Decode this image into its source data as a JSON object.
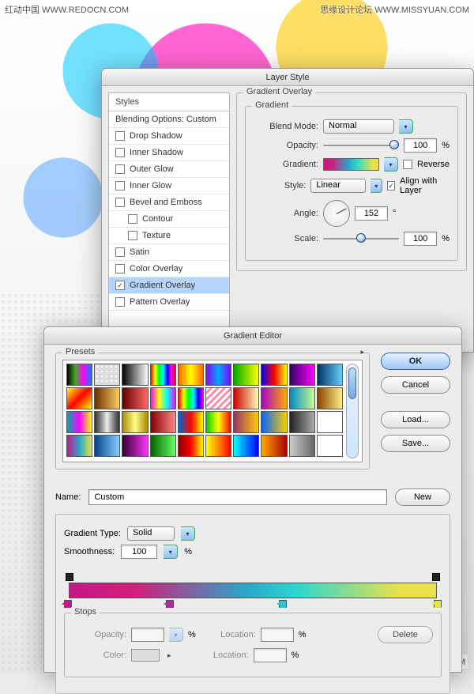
{
  "watermarks": {
    "tl": "红动中国 WWW.REDOCN.COM",
    "tr": "思缘设计论坛 WWW.MISSYUAN.COM",
    "br": "红动中国 WWW.REDOCN.COM"
  },
  "layerStyle": {
    "title": "Layer Style",
    "leftHeader": "Styles",
    "blendingOptions": "Blending Options: Custom",
    "items": [
      {
        "label": "Drop Shadow",
        "checked": false,
        "sub": false
      },
      {
        "label": "Inner Shadow",
        "checked": false,
        "sub": false
      },
      {
        "label": "Outer Glow",
        "checked": false,
        "sub": false
      },
      {
        "label": "Inner Glow",
        "checked": false,
        "sub": false
      },
      {
        "label": "Bevel and Emboss",
        "checked": false,
        "sub": false
      },
      {
        "label": "Contour",
        "checked": false,
        "sub": true
      },
      {
        "label": "Texture",
        "checked": false,
        "sub": true
      },
      {
        "label": "Satin",
        "checked": false,
        "sub": false
      },
      {
        "label": "Color Overlay",
        "checked": false,
        "sub": false
      },
      {
        "label": "Gradient Overlay",
        "checked": true,
        "sub": false,
        "selected": true
      },
      {
        "label": "Pattern Overlay",
        "checked": false,
        "sub": false
      }
    ],
    "groupTitle": "Gradient Overlay",
    "subgroupTitle": "Gradient",
    "blendModeLabel": "Blend Mode:",
    "blendMode": "Normal",
    "opacityLabel": "Opacity:",
    "opacity": "100",
    "pct": "%",
    "gradientLabel": "Gradient:",
    "reverseLabel": "Reverse",
    "reverse": false,
    "styleLabel": "Style:",
    "style": "Linear",
    "alignLabel": "Align with Layer",
    "align": true,
    "angleLabel": "Angle:",
    "angle": "152",
    "deg": "°",
    "scaleLabel": "Scale:",
    "scale": "100"
  },
  "gradientEditor": {
    "title": "Gradient Editor",
    "presetsLabel": "Presets",
    "ok": "OK",
    "cancel": "Cancel",
    "load": "Load...",
    "save": "Save...",
    "nameLabel": "Name:",
    "name": "Custom",
    "new": "New",
    "gradientTypeLabel": "Gradient Type:",
    "gradientType": "Solid",
    "smoothnessLabel": "Smoothness:",
    "smoothness": "100",
    "pct": "%",
    "stopsLabel": "Stops",
    "opacityLabel": "Opacity:",
    "colorLabel": "Color:",
    "locationLabel": "Location:",
    "delete": "Delete",
    "swatches": [
      "linear-gradient(90deg,#000,#4a2,#f0f,#08f)",
      "radial-gradient(#fff 25%,transparent 26%) 0 0/6px 6px,linear-gradient(#ddd,#ddd)",
      "linear-gradient(90deg,#000,#fff)",
      "linear-gradient(90deg,#f00,#ff0,#0f0,#0ff,#00f,#f0f,#f00)",
      "linear-gradient(90deg,#f60,#ff0,#f60)",
      "linear-gradient(90deg,#80f,#0af,#80f)",
      "linear-gradient(90deg,#0a0,#ff0)",
      "linear-gradient(90deg,#00f,#f00,#ff0)",
      "linear-gradient(90deg,#306,#f0f)",
      "linear-gradient(90deg,#036,#6cf)",
      "linear-gradient(135deg,#ff0,#f00 50%,#ff0)",
      "linear-gradient(90deg,#630,#fc6)",
      "linear-gradient(90deg,#600,#f66)",
      "linear-gradient(90deg,#f0f,#ff0,#0ff,#f0f)",
      "linear-gradient(90deg,#f00,#ff0,#0f0,#0ff,#00f,#f0f)",
      "repeating-linear-gradient(135deg,#fff 0 3px,#f8a 3px 6px)",
      "linear-gradient(90deg,#c00,#ffb)",
      "linear-gradient(90deg,#a0c,#fa0)",
      "linear-gradient(90deg,#08c,#cf8)",
      "linear-gradient(90deg,#840,#fe8)",
      "linear-gradient(90deg,#0aa,#f0f,#ff0)",
      "linear-gradient(90deg,#333,#888,#eee,#888,#333)",
      "linear-gradient(90deg,#a80,#ff8,#a80)",
      "linear-gradient(90deg,#800,#f88)",
      "linear-gradient(90deg,#06c,#f00,#ff0)",
      "linear-gradient(90deg,#0c0,#ff0,#f00)",
      "linear-gradient(90deg,#936,#fc0)",
      "linear-gradient(90deg,#06f,#fc0)",
      "linear-gradient(90deg,#222,#aaa)",
      "linear-gradient(90deg,#fff,#fff)",
      "linear-gradient(90deg,#c3178a,#2aa6c9,#e9e14a)",
      "linear-gradient(90deg,#048,#8cf)",
      "linear-gradient(90deg,#303,#f3f)",
      "linear-gradient(90deg,#060,#6f6)",
      "linear-gradient(90deg,#800,#f00,#ff0)",
      "linear-gradient(90deg,#ff0,#f80,#f00)",
      "linear-gradient(90deg,#0ff,#00f)",
      "linear-gradient(90deg,#fa0,#a00)",
      "linear-gradient(90deg,#ccc,#666)",
      "linear-gradient(90deg,#fff,#fff)"
    ],
    "colorStops": [
      {
        "pos": 1,
        "color": "#c3178a"
      },
      {
        "pos": 28,
        "color": "#b22a9a"
      },
      {
        "pos": 58,
        "color": "#2bc6d0"
      },
      {
        "pos": 99,
        "color": "#e9e14a"
      }
    ]
  }
}
